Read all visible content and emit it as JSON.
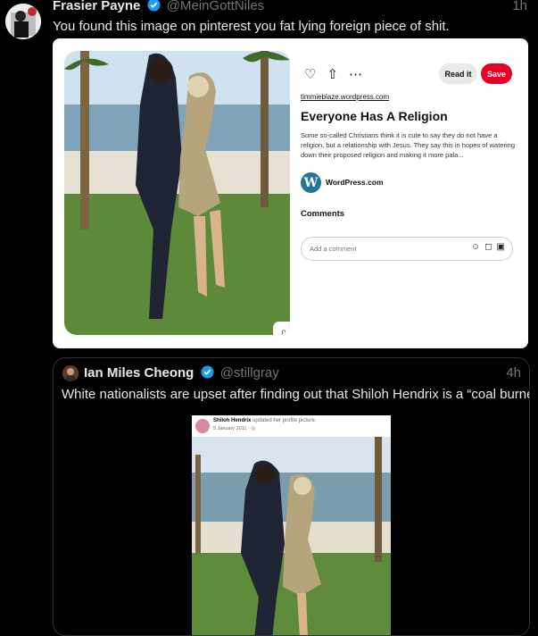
{
  "tweet": {
    "author_name": "Frasier Payne",
    "handle": "@MeinGottNiles",
    "time": "1h",
    "text": "You found this image on pinterest you fat lying foreign piece of shit."
  },
  "pin": {
    "domain": "timmieblaze.wordpress.com",
    "title": "Everyone Has A Religion",
    "description": "Some so-called Christians think it is cute to say they do not have a religion, but a relationship with Jesus. They say this in hopes of watering down their proposed religion and making it more pala...",
    "source_name": "WordPress.com",
    "read_it_label": "Read it",
    "save_label": "Save",
    "comments_heading": "Comments",
    "comment_placeholder": "Add a comment",
    "icons": [
      "heart-icon",
      "share-icon",
      "more-icon",
      "visual-search-icon",
      "emoji-icon",
      "sticker-icon",
      "image-icon"
    ]
  },
  "quote": {
    "author_name": "Ian Miles Cheong",
    "handle": "@stillgray",
    "time": "4h",
    "text": "White nationalists are upset after finding out that Shiloh Hendrix is a “coal burner.”",
    "fb": {
      "name": "Shiloh Hendrix",
      "action": " updated her profile picture.",
      "date": "5 January 2011 · "
    }
  },
  "colors": {
    "background": "#000000",
    "verified": "#1d9bf0",
    "pinterest_red": "#e60023",
    "muted_text": "#71767b"
  }
}
